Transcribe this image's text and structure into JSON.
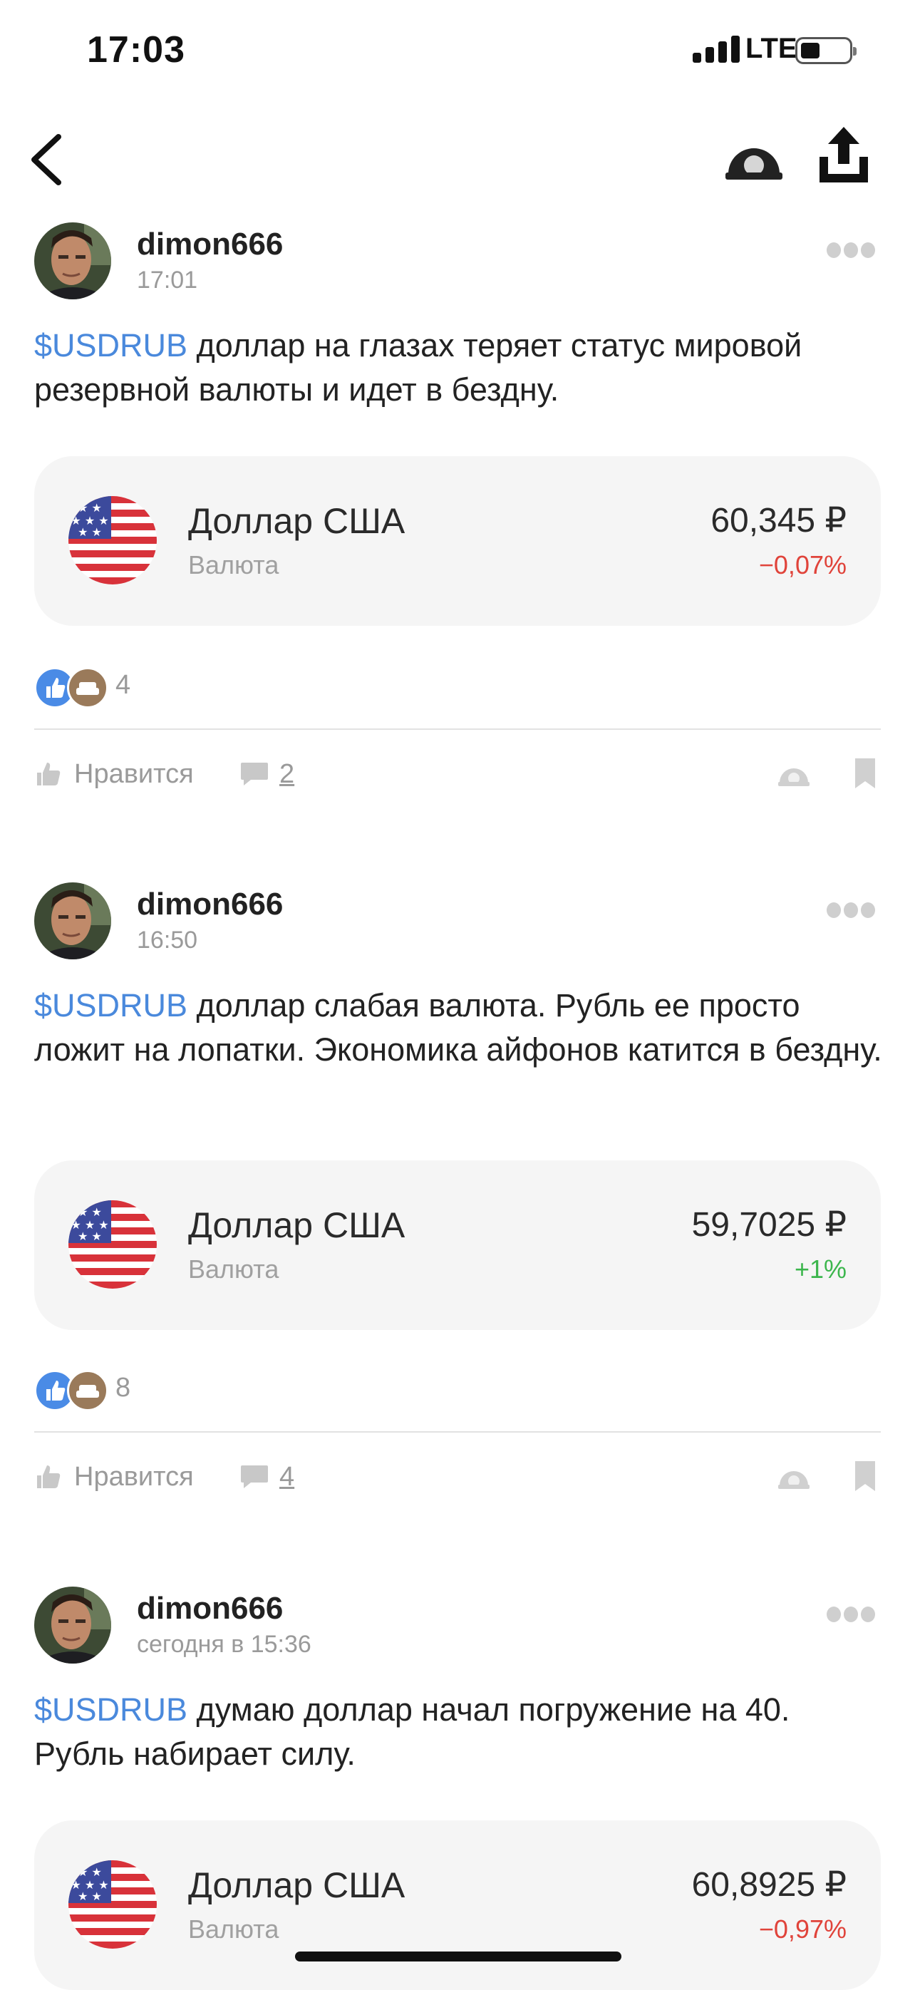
{
  "status_bar": {
    "time": "17:03",
    "network": "LTE"
  },
  "nav": {
    "back_icon": "chevron-left-icon",
    "observe_icon": "observe-icon",
    "share_icon": "share-icon"
  },
  "posts": [
    {
      "author": "dimon666",
      "time": "17:01",
      "ticker": "$USDRUB",
      "text": " доллар на глазах теряет статус мировой резервной валюты и идет в бездну.",
      "card": {
        "title": "Доллар США",
        "subtitle": "Валюта",
        "price": "60,345 ₽",
        "change": "−0,07%",
        "direction": "down"
      },
      "reactions_count": "4",
      "like_label": "Нравится",
      "comments_count": "2"
    },
    {
      "author": "dimon666",
      "time": "16:50",
      "ticker": "$USDRUB",
      "text": " доллар слабая валюта. Рубль ее просто ложит на лопатки. Экономика айфонов катится в бездну.",
      "card": {
        "title": "Доллар США",
        "subtitle": "Валюта",
        "price": "59,7025 ₽",
        "change": "+1%",
        "direction": "up"
      },
      "reactions_count": "8",
      "like_label": "Нравится",
      "comments_count": "4"
    },
    {
      "author": "dimon666",
      "time": "сегодня в 15:36",
      "ticker": "$USDRUB",
      "text": " думаю доллар начал погружение на 40. Рубль набирает силу.",
      "card": {
        "title": "Доллар США",
        "subtitle": "Валюта",
        "price": "60,8925 ₽",
        "change": "−0,97%",
        "direction": "down"
      }
    }
  ],
  "colors": {
    "ticker": "#4a89dc",
    "negative": "#e0433a",
    "positive": "#3cb64d",
    "card_bg": "#f5f5f5"
  }
}
